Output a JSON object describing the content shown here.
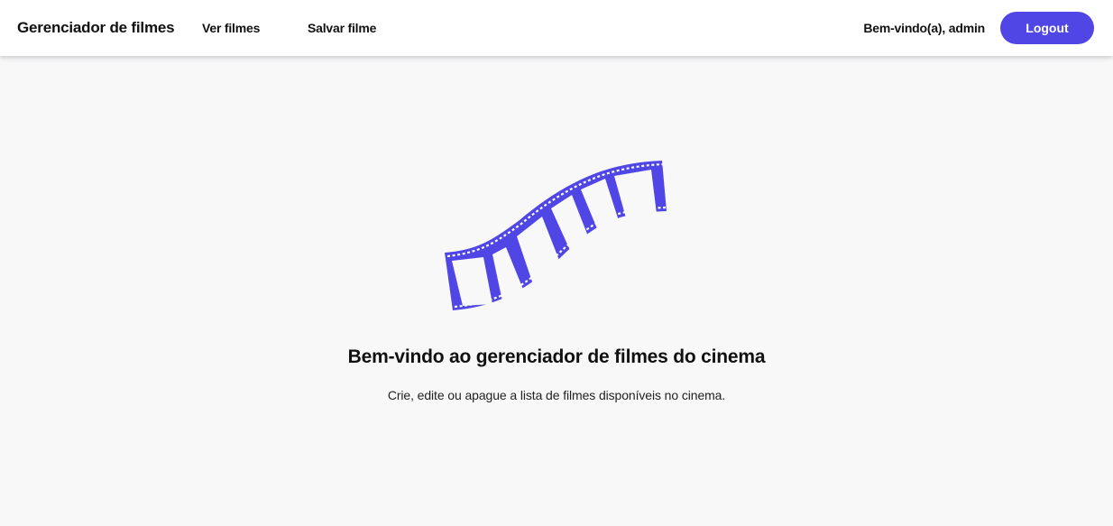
{
  "navbar": {
    "brand": "Gerenciador de filmes",
    "links": [
      {
        "label": "Ver filmes"
      },
      {
        "label": "Salvar filme"
      }
    ],
    "welcome": "Bem-vindo(a), admin",
    "logout_label": "Logout"
  },
  "hero": {
    "title": "Bem-vindo ao gerenciador de filmes do cinema",
    "subtitle": "Crie, edite ou apague a lista de filmes disponíveis no cinema.",
    "illustration_icon": "film-strip-icon"
  },
  "colors": {
    "accent": "#4f46e5",
    "background": "#f8f8f9",
    "navbar_bg": "#ffffff"
  }
}
